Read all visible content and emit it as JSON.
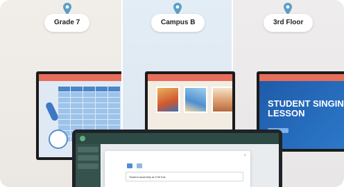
{
  "locations": [
    {
      "label": "Grade 7"
    },
    {
      "label": "Campus B"
    },
    {
      "label": "3rd Floor"
    }
  ],
  "colors": {
    "pin": "#5a9ec6",
    "pill_bg": "#ffffff",
    "panel1_bg": "#efece8",
    "panel2_bg": "#e1ebf4",
    "panel3_bg": "#ecebeb",
    "slide_header": "#e66e5a",
    "promo_bg": "#2468b8",
    "app_dark": "#2e4a45"
  },
  "screens": {
    "promo": {
      "title_line1": "STUDENT SINGING",
      "title_line2": "LESSON"
    }
  },
  "laptop": {
    "message_text": "Student assembly at 9:00 this"
  },
  "icons": [
    "location-pin-icon",
    "clock-icon",
    "test-tube-icon",
    "close-icon"
  ]
}
